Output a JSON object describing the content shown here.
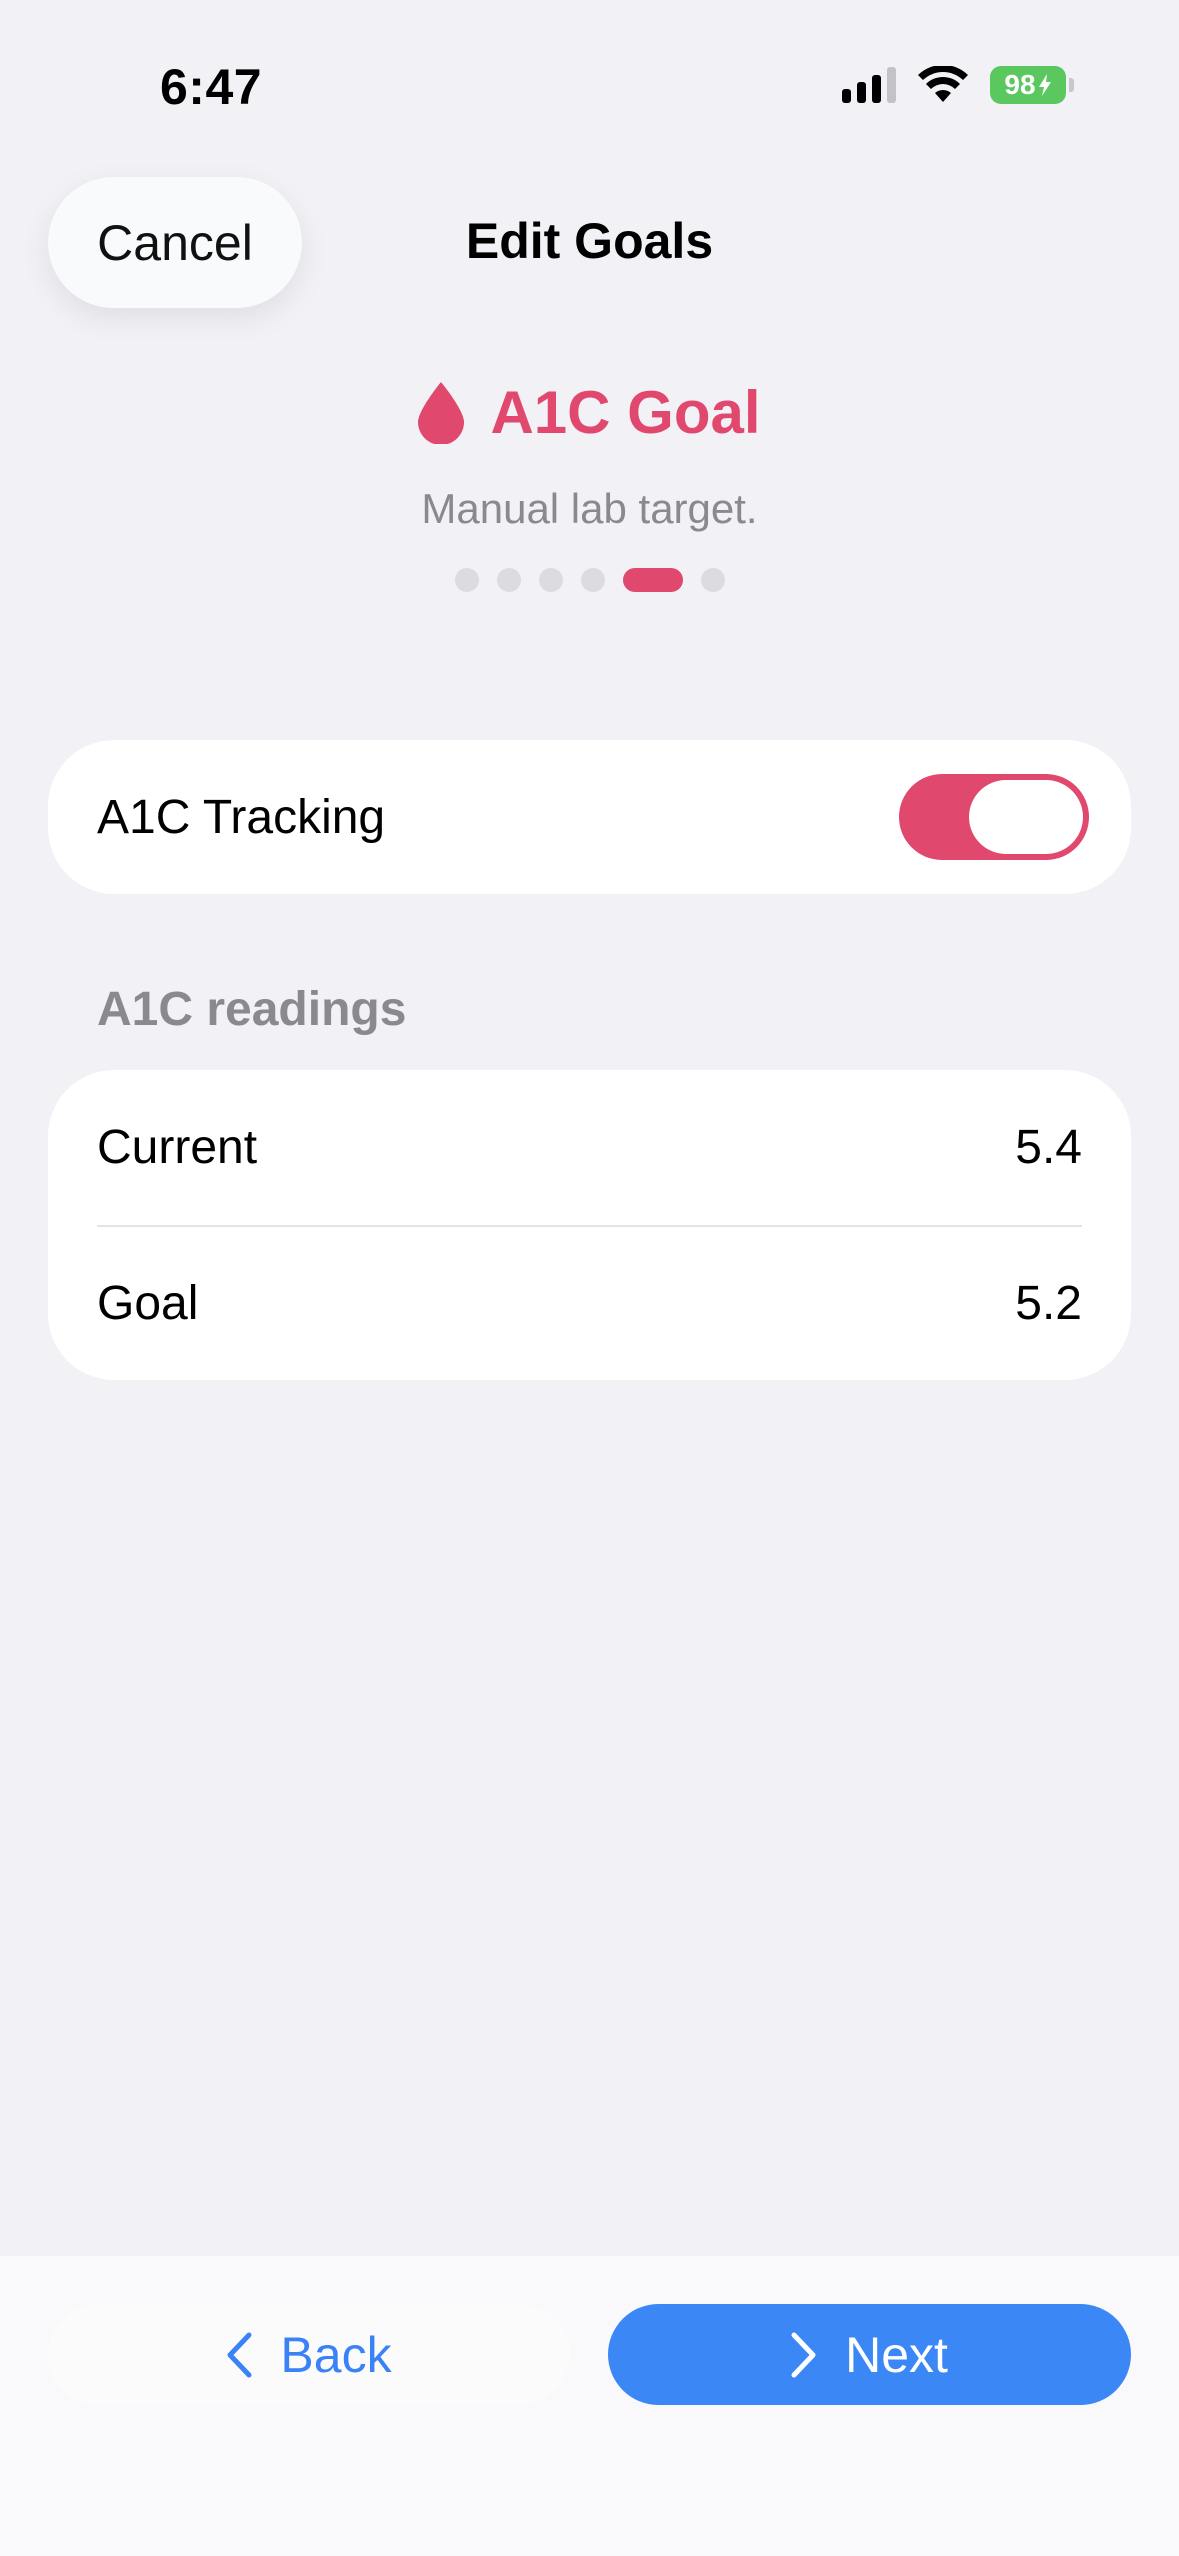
{
  "status_bar": {
    "time": "6:47",
    "battery": "98",
    "icons": [
      "cellular-signal-icon",
      "wifi-icon",
      "battery-charging-icon"
    ]
  },
  "nav": {
    "cancel_label": "Cancel",
    "title": "Edit Goals"
  },
  "goal": {
    "icon": "blood-drop-icon",
    "title": "A1C Goal",
    "subtitle": "Manual lab target.",
    "page_count": 6,
    "current_page": 5
  },
  "tracking": {
    "label": "A1C Tracking",
    "enabled": true
  },
  "readings": {
    "header": "A1C readings",
    "rows": [
      {
        "label": "Current",
        "value": "5.4"
      },
      {
        "label": "Goal",
        "value": "5.2"
      }
    ]
  },
  "footer": {
    "back_label": "Back",
    "next_label": "Next"
  },
  "colors": {
    "accent": "#e0486e",
    "primary_button": "#3b87f5",
    "background": "#f1f1f6"
  }
}
